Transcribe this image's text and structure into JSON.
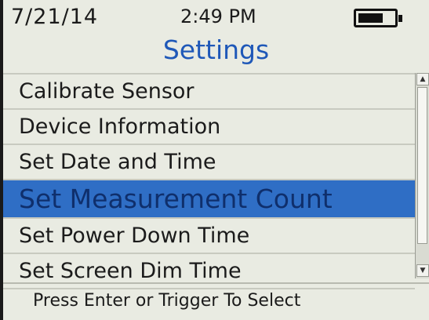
{
  "status_bar": {
    "date": "7/21/14",
    "time": "2:49 PM",
    "battery_icon": "battery-icon",
    "battery_level": 0.7
  },
  "title": "Settings",
  "menu": {
    "items": [
      {
        "label": "Calibrate Sensor",
        "selected": false
      },
      {
        "label": "Device Information",
        "selected": false
      },
      {
        "label": "Set Date and Time",
        "selected": false
      },
      {
        "label": "Set Measurement Count",
        "selected": true
      },
      {
        "label": "Set Power Down Time",
        "selected": false
      },
      {
        "label": "Set Screen Dim Time",
        "selected": false
      }
    ]
  },
  "scrollbar": {
    "up_icon": "scroll-up-arrow-icon",
    "down_icon": "scroll-down-arrow-icon"
  },
  "footer": {
    "hint": "Press Enter or Trigger To Select"
  },
  "colors": {
    "title": "#1f58b8",
    "selection": "#2f6ec5",
    "background": "#e9ebe2"
  }
}
